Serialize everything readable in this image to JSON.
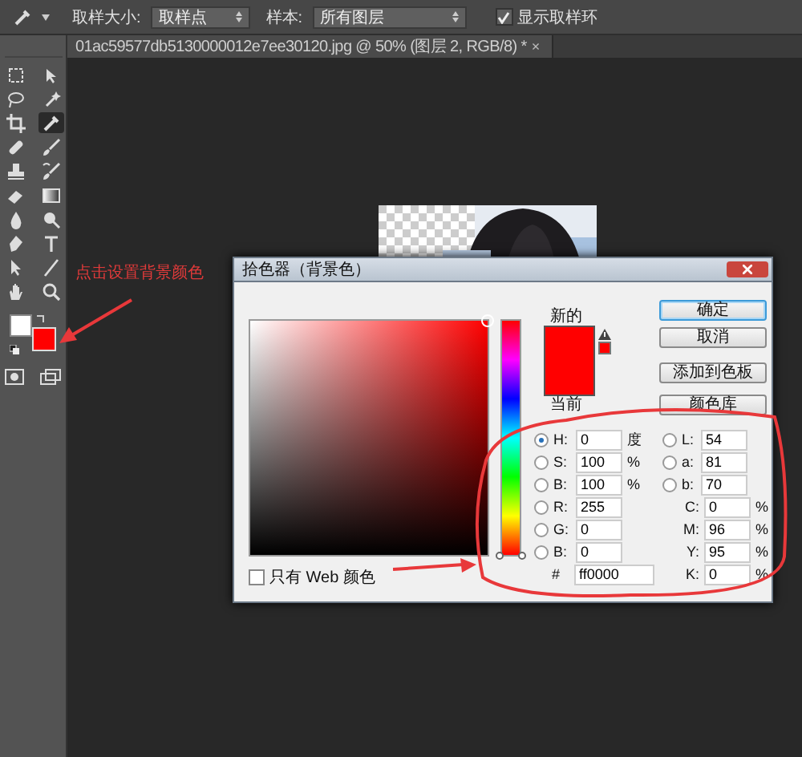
{
  "options_bar": {
    "sample_size_label": "取样大小:",
    "sample_size": "取样点",
    "sample_label": "样本:",
    "sample": "所有图层",
    "show_ring": {
      "label": "显示取样环",
      "checked": true
    }
  },
  "document_tab": {
    "title": "01ac59577db5130000012e7ee30120.jpg @ 50% (图层 2, RGB/8) *",
    "close": "×"
  },
  "toolbar": {
    "tools": [
      {
        "selected": false
      },
      {
        "selected": false
      },
      {
        "selected": false
      },
      {
        "selected": false
      },
      {
        "selected": false
      },
      {
        "selected": true
      },
      {
        "selected": false
      },
      {
        "selected": false
      },
      {
        "selected": false
      },
      {
        "selected": false
      },
      {
        "selected": false
      },
      {
        "selected": false
      },
      {
        "selected": false
      },
      {
        "selected": false
      },
      {
        "selected": false
      },
      {
        "selected": false
      },
      {
        "selected": false
      },
      {
        "selected": false
      },
      {
        "selected": false
      },
      {
        "selected": false
      }
    ]
  },
  "annotation": {
    "text": "点击设置背景颜色"
  },
  "color_picker": {
    "title": "拾色器（背景色）",
    "new_label": "新的",
    "current_label": "当前",
    "hue_slider": {
      "level": 0
    },
    "buttons": [
      {
        "label": "确定",
        "default": true
      },
      {
        "label": "取消",
        "default": false
      },
      {
        "label": "添加到色板",
        "default": false
      },
      {
        "label": "颜色库",
        "default": false
      }
    ],
    "left_fields": [
      {
        "kind": "radio",
        "label": "H:",
        "value": "0",
        "unit": "度",
        "selected": true
      },
      {
        "kind": "radio",
        "label": "S:",
        "value": "100",
        "unit": "%",
        "selected": false
      },
      {
        "kind": "radio",
        "label": "B:",
        "value": "100",
        "unit": "%",
        "selected": false
      },
      {
        "kind": "radio",
        "label": "R:",
        "value": "255",
        "selected": false
      },
      {
        "kind": "radio",
        "label": "G:",
        "value": "0",
        "selected": false
      },
      {
        "kind": "radio",
        "label": "B:",
        "value": "0",
        "selected": false
      },
      {
        "kind": "hex",
        "label": "#",
        "value": "ff0000"
      }
    ],
    "right_fields": [
      {
        "kind": "radio",
        "label": "L:",
        "value": "54",
        "selected": false
      },
      {
        "kind": "radio",
        "label": "a:",
        "value": "81",
        "selected": false
      },
      {
        "kind": "radio",
        "label": "b:",
        "value": "70",
        "selected": false
      },
      {
        "kind": "plain",
        "label": "C:",
        "value": "0",
        "unit": "%"
      },
      {
        "kind": "plain",
        "label": "M:",
        "value": "96",
        "unit": "%"
      },
      {
        "kind": "plain",
        "label": "Y:",
        "value": "95",
        "unit": "%"
      },
      {
        "kind": "plain",
        "label": "K:",
        "value": "0",
        "unit": "%"
      }
    ],
    "web_only": {
      "label": "只有 Web 颜色",
      "checked": false
    }
  }
}
